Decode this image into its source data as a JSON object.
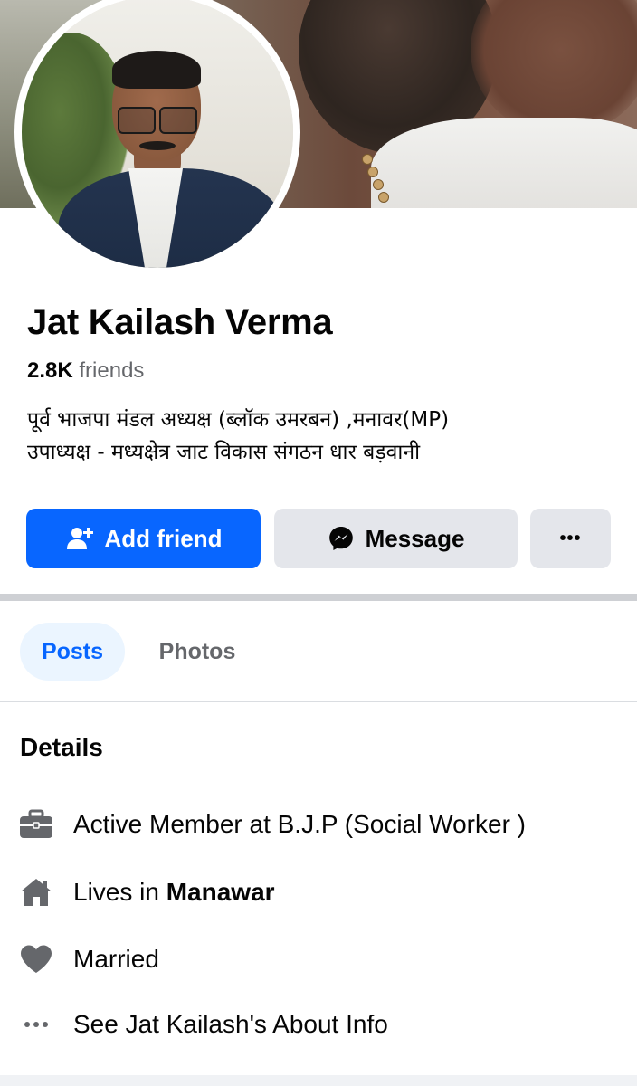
{
  "profile": {
    "name": "Jat Kailash Verma",
    "friends_count": "2.8K",
    "friends_label": "friends",
    "bio_line1": "पूर्व भाजपा मंडल अध्यक्ष (ब्लॉक उमरबन) ,मनावर(MP)",
    "bio_line2": "उपाध्यक्ष - मध्यक्षेत्र जाट विकास संगठन धार बड़वानी"
  },
  "actions": {
    "add_friend_label": "Add friend",
    "message_label": "Message",
    "more_label": "•••"
  },
  "tabs": [
    {
      "label": "Posts",
      "active": true
    },
    {
      "label": "Photos",
      "active": false
    }
  ],
  "details": {
    "title": "Details",
    "work": "Active Member at B.J.P  (Social Worker )",
    "lives_prefix": "Lives in",
    "lives_place": "Manawar",
    "relationship": "Married",
    "about_link": "See Jat Kailash's About Info"
  },
  "colors": {
    "primary_blue": "#0866ff",
    "button_gray": "#e4e6eb",
    "secondary_text": "#65676b",
    "tab_active_bg": "#ebf5ff",
    "icon_gray": "#65676b"
  },
  "icons": {
    "add_friend": "person-add-icon",
    "message": "messenger-icon",
    "more": "more-horizontal-icon",
    "work": "briefcase-icon",
    "lives": "home-icon",
    "relationship": "heart-icon",
    "about": "more-dots-icon"
  }
}
